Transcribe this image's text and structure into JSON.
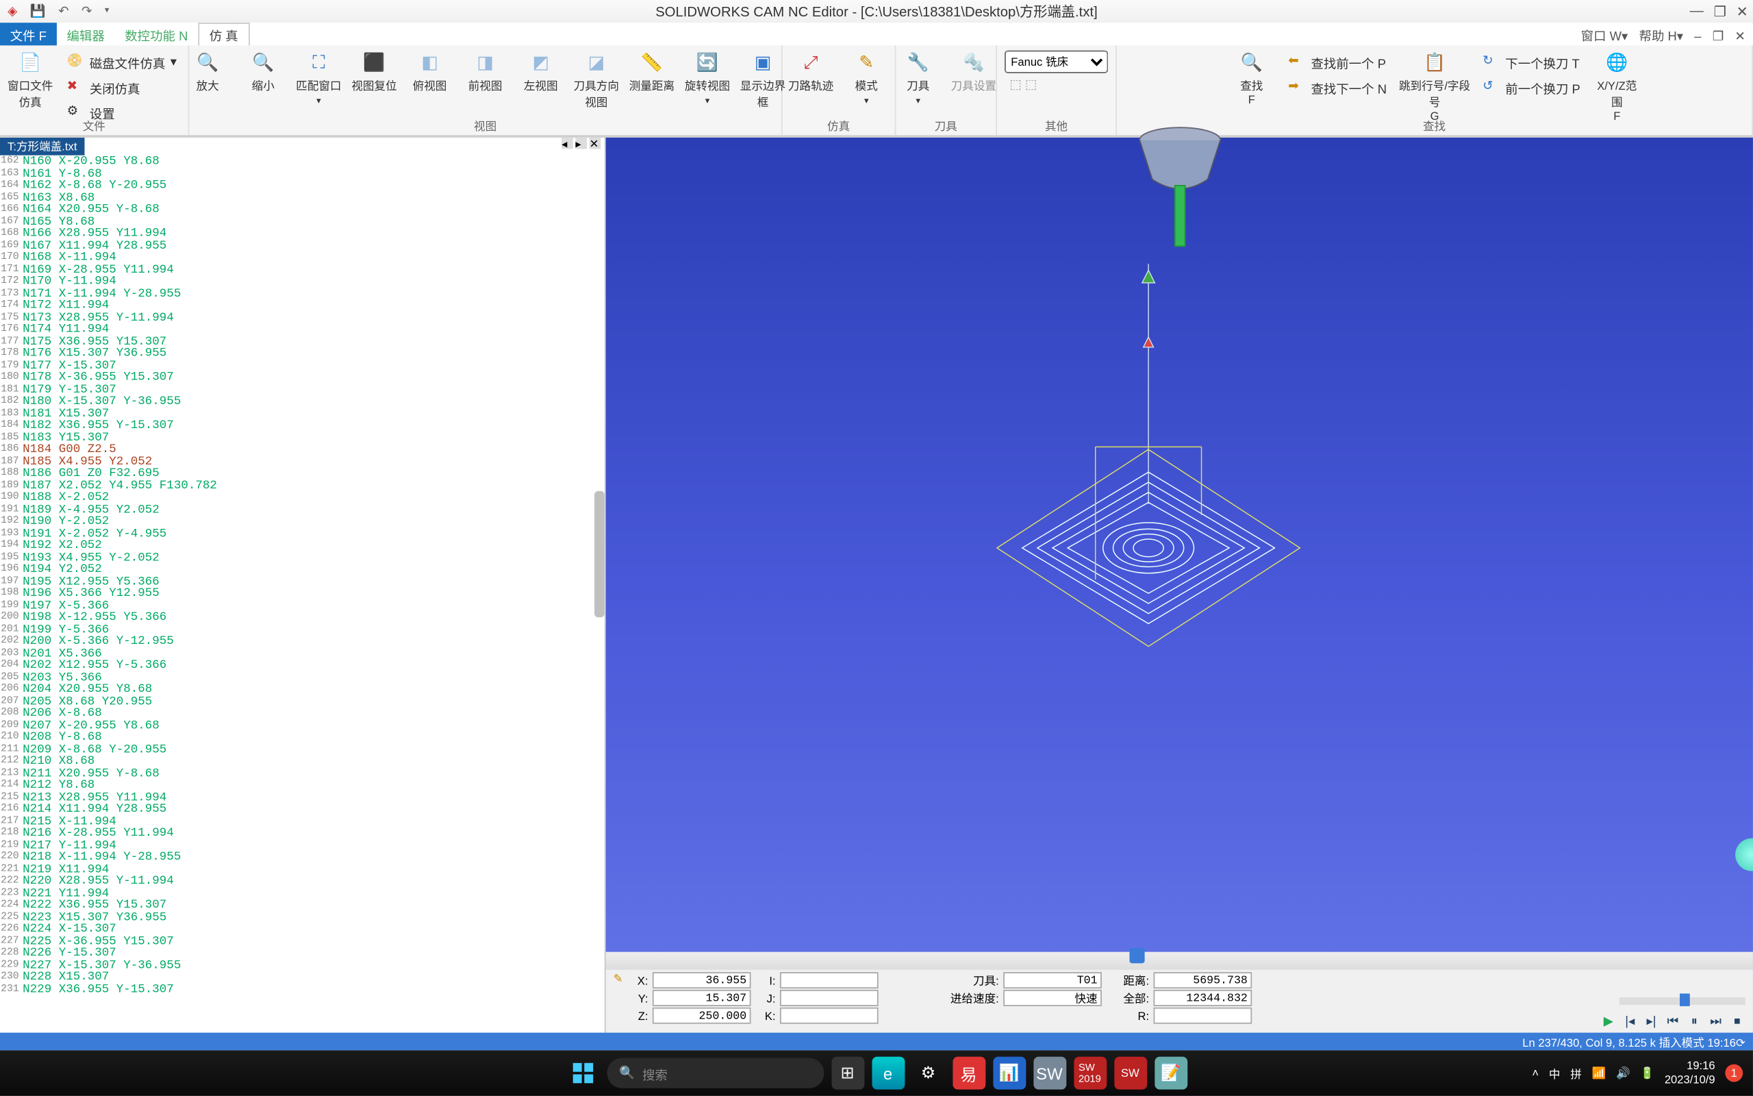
{
  "title": "SOLIDWORKS CAM NC Editor - [C:\\Users\\18381\\Desktop\\方形端盖.txt]",
  "menus": {
    "file": "文件 F",
    "editor": "编辑器",
    "nc": "数控功能 N",
    "sim": "仿 真",
    "right": {
      "win": "窗口 W▾",
      "help": "帮助 H▾",
      "dash": "–",
      "max": "❐",
      "close": "✕"
    }
  },
  "ribbon": {
    "groups": {
      "file": "文件",
      "view": "视图",
      "sim": "仿真",
      "tool": "刀具",
      "other": "其他",
      "search": "查找"
    },
    "buttons": {
      "winBackup": "窗口文件仿真",
      "diskFileSim": "磁盘文件仿真",
      "closeSim": "关闭仿真",
      "settings": "设置",
      "zoomIn": "放大",
      "zoomOut": "缩小",
      "fitWin": "匹配窗口",
      "viewReset": "视图复位",
      "topView": "俯视图",
      "frontView": "前视图",
      "leftView": "左视图",
      "toolDir": "刀具方向视图",
      "measure": "测量距离",
      "rotateView": "旋转视图",
      "showBounds": "显示边界框",
      "toolpath": "刀路轨迹",
      "mode": "模式",
      "tool": "刀具",
      "toolSet": "刀具设置",
      "controller": "Fanuc 铣床",
      "search": "查找\nF",
      "findPrevP": "查找前一个 P",
      "findNextN": "查找下一个 N",
      "gotoLine": "跳到行号/字段号\nG",
      "nextToolT": "下一个换刀 T",
      "prevToolP": "前一个换刀 P",
      "xyzRange": "X/Y/Z范围\nF"
    }
  },
  "fileTab": "T:方形端盖.txt",
  "code": [
    {
      "ln": 162,
      "t": "N160 X-20.955 Y8.68",
      "c": "x"
    },
    {
      "ln": 163,
      "t": "N161 Y-8.68",
      "c": "x"
    },
    {
      "ln": 164,
      "t": "N162 X-8.68 Y-20.955",
      "c": "x"
    },
    {
      "ln": 165,
      "t": "N163 X8.68",
      "c": "x"
    },
    {
      "ln": 166,
      "t": "N164 X20.955 Y-8.68",
      "c": "x"
    },
    {
      "ln": 167,
      "t": "N165 Y8.68",
      "c": "x"
    },
    {
      "ln": 168,
      "t": "N166 X28.955 Y11.994",
      "c": "x"
    },
    {
      "ln": 169,
      "t": "N167 X11.994 Y28.955",
      "c": "x"
    },
    {
      "ln": 170,
      "t": "N168 X-11.994",
      "c": "x"
    },
    {
      "ln": 171,
      "t": "N169 X-28.955 Y11.994",
      "c": "x"
    },
    {
      "ln": 172,
      "t": "N170 Y-11.994",
      "c": "x"
    },
    {
      "ln": 173,
      "t": "N171 X-11.994 Y-28.955",
      "c": "x"
    },
    {
      "ln": 174,
      "t": "N172 X11.994",
      "c": "x"
    },
    {
      "ln": 175,
      "t": "N173 X28.955 Y-11.994",
      "c": "x"
    },
    {
      "ln": 176,
      "t": "N174 Y11.994",
      "c": "x"
    },
    {
      "ln": 177,
      "t": "N175 X36.955 Y15.307",
      "c": "x"
    },
    {
      "ln": 178,
      "t": "N176 X15.307 Y36.955",
      "c": "x"
    },
    {
      "ln": 179,
      "t": "N177 X-15.307",
      "c": "x"
    },
    {
      "ln": 180,
      "t": "N178 X-36.955 Y15.307",
      "c": "x"
    },
    {
      "ln": 181,
      "t": "N179 Y-15.307",
      "c": "x"
    },
    {
      "ln": 182,
      "t": "N180 X-15.307 Y-36.955",
      "c": "x"
    },
    {
      "ln": 183,
      "t": "N181 X15.307",
      "c": "x"
    },
    {
      "ln": 184,
      "t": "N182 X36.955 Y-15.307",
      "c": "x"
    },
    {
      "ln": 185,
      "t": "N183 Y15.307",
      "c": "x"
    },
    {
      "ln": 186,
      "t": "N184 G00 Z2.5",
      "c": "rapid"
    },
    {
      "ln": 187,
      "t": "N185 X4.955 Y2.052",
      "c": "rapid"
    },
    {
      "ln": 188,
      "t": "N186 G01 Z0 F32.695",
      "c": "x"
    },
    {
      "ln": 189,
      "t": "N187 X2.052 Y4.955 F130.782",
      "c": "x"
    },
    {
      "ln": 190,
      "t": "N188 X-2.052",
      "c": "x"
    },
    {
      "ln": 191,
      "t": "N189 X-4.955 Y2.052",
      "c": "x"
    },
    {
      "ln": 192,
      "t": "N190 Y-2.052",
      "c": "x"
    },
    {
      "ln": 193,
      "t": "N191 X-2.052 Y-4.955",
      "c": "x"
    },
    {
      "ln": 194,
      "t": "N192 X2.052",
      "c": "x"
    },
    {
      "ln": 195,
      "t": "N193 X4.955 Y-2.052",
      "c": "x"
    },
    {
      "ln": 196,
      "t": "N194 Y2.052",
      "c": "x"
    },
    {
      "ln": 197,
      "t": "N195 X12.955 Y5.366",
      "c": "x"
    },
    {
      "ln": 198,
      "t": "N196 X5.366 Y12.955",
      "c": "x"
    },
    {
      "ln": 199,
      "t": "N197 X-5.366",
      "c": "x"
    },
    {
      "ln": 200,
      "t": "N198 X-12.955 Y5.366",
      "c": "x"
    },
    {
      "ln": 201,
      "t": "N199 Y-5.366",
      "c": "x"
    },
    {
      "ln": 202,
      "t": "N200 X-5.366 Y-12.955",
      "c": "x"
    },
    {
      "ln": 203,
      "t": "N201 X5.366",
      "c": "x"
    },
    {
      "ln": 204,
      "t": "N202 X12.955 Y-5.366",
      "c": "x"
    },
    {
      "ln": 205,
      "t": "N203 Y5.366",
      "c": "x"
    },
    {
      "ln": 206,
      "t": "N204 X20.955 Y8.68",
      "c": "x"
    },
    {
      "ln": 207,
      "t": "N205 X8.68 Y20.955",
      "c": "x"
    },
    {
      "ln": 208,
      "t": "N206 X-8.68",
      "c": "x"
    },
    {
      "ln": 209,
      "t": "N207 X-20.955 Y8.68",
      "c": "x"
    },
    {
      "ln": 210,
      "t": "N208 Y-8.68",
      "c": "x"
    },
    {
      "ln": 211,
      "t": "N209 X-8.68 Y-20.955",
      "c": "x"
    },
    {
      "ln": 212,
      "t": "N210 X8.68",
      "c": "x"
    },
    {
      "ln": 213,
      "t": "N211 X20.955 Y-8.68",
      "c": "x"
    },
    {
      "ln": 214,
      "t": "N212 Y8.68",
      "c": "x"
    },
    {
      "ln": 215,
      "t": "N213 X28.955 Y11.994",
      "c": "x"
    },
    {
      "ln": 216,
      "t": "N214 X11.994 Y28.955",
      "c": "x"
    },
    {
      "ln": 217,
      "t": "N215 X-11.994",
      "c": "x"
    },
    {
      "ln": 218,
      "t": "N216 X-28.955 Y11.994",
      "c": "x"
    },
    {
      "ln": 219,
      "t": "N217 Y-11.994",
      "c": "x"
    },
    {
      "ln": 220,
      "t": "N218 X-11.994 Y-28.955",
      "c": "x"
    },
    {
      "ln": 221,
      "t": "N219 X11.994",
      "c": "x"
    },
    {
      "ln": 222,
      "t": "N220 X28.955 Y-11.994",
      "c": "x"
    },
    {
      "ln": 223,
      "t": "N221 Y11.994",
      "c": "x"
    },
    {
      "ln": 224,
      "t": "N222 X36.955 Y15.307",
      "c": "x"
    },
    {
      "ln": 225,
      "t": "N223 X15.307 Y36.955",
      "c": "x"
    },
    {
      "ln": 226,
      "t": "N224 X-15.307",
      "c": "x"
    },
    {
      "ln": 227,
      "t": "N225 X-36.955 Y15.307",
      "c": "x"
    },
    {
      "ln": 228,
      "t": "N226 Y-15.307",
      "c": "x"
    },
    {
      "ln": 229,
      "t": "N227 X-15.307 Y-36.955",
      "c": "x"
    },
    {
      "ln": 230,
      "t": "N228 X15.307",
      "c": "x"
    },
    {
      "ln": 231,
      "t": "N229 X36.955 Y-15.307",
      "c": "x"
    }
  ],
  "coords": {
    "X": "36.955",
    "Y": "15.307",
    "Z": "250.000",
    "I": "",
    "J": "",
    "K": "",
    "tool_lbl": "刀具:",
    "tool": "T01",
    "feed_lbl": "进给速度:",
    "feed": "快速",
    "dist_lbl": "距离:",
    "dist": "5695.738",
    "total_lbl": "全部:",
    "total": "12344.832",
    "R_lbl": "R:",
    "R": ""
  },
  "status": "Ln 237/430, Col 9, 8.125 k 插入模式  19:16⟳",
  "taskbar": {
    "search": "搜索",
    "time": "19:16",
    "date": "2023/10/9",
    "lang": "中",
    "pinyin": "拼"
  }
}
